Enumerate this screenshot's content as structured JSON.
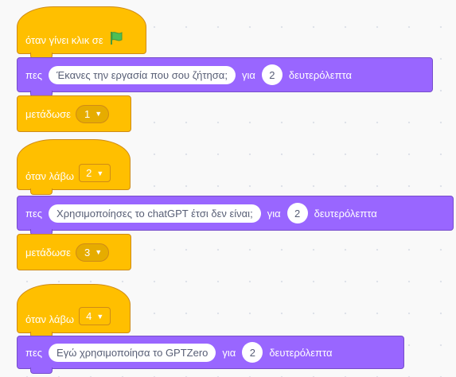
{
  "script1": {
    "hat_label": "όταν γίνει κλικ σε",
    "flag_icon": "green-flag-icon",
    "say_label": "πες",
    "say_text": "Έκανες την εργασία που σου ζήτησα;",
    "for_label": "για",
    "secs": "2",
    "secs_label": "δευτερόλεπτα",
    "broadcast_label": "μετάδωσε",
    "broadcast_value": "1"
  },
  "script2": {
    "hat_label": "όταν λάβω",
    "hat_value": "2",
    "say_label": "πες",
    "say_text": "Χρησιμοποίησες το chatGPT έτσι δεν είναι;",
    "for_label": "για",
    "secs": "2",
    "secs_label": "δευτερόλεπτα",
    "broadcast_label": "μετάδωσε",
    "broadcast_value": "3"
  },
  "script3": {
    "hat_label": "όταν λάβω",
    "hat_value": "4",
    "say_label": "πες",
    "say_text": "Εγώ χρησιμοποίησα το GPTZero",
    "for_label": "για",
    "secs": "2",
    "secs_label": "δευτερόλεπτα"
  },
  "colors": {
    "events": "#FFBF00",
    "looks": "#9966FF",
    "flag": "#4CBF56"
  }
}
